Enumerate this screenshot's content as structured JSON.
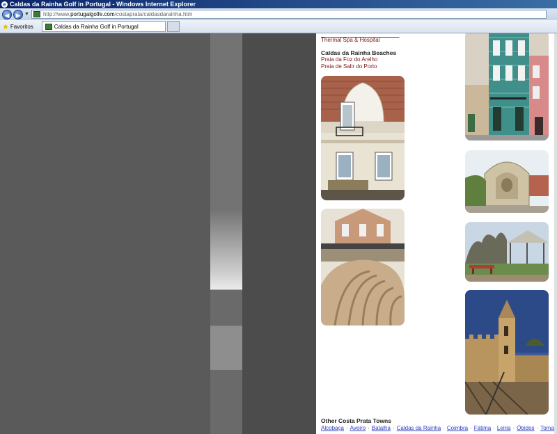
{
  "window": {
    "title": "Caldas da Rainha Golf in Portugal - Windows Internet Explorer"
  },
  "address": {
    "url_prefix": "http://www.",
    "url_host": "portugalgolfe.com",
    "url_path": "/costaprata/caldasdarainha.htm"
  },
  "toolbar": {
    "favorites_label": "Favoritos",
    "tab_title": "Caldas da Rainha Golf in Portugal"
  },
  "content": {
    "spa_link": "Thermal Spa & Hospital",
    "beaches_heading": "Caldas da Rainha Beaches",
    "beaches": [
      "Praia da Foz do Arelho",
      "Praia de Salir do Porto"
    ],
    "other_towns_heading": "Other Costa Prata Towns",
    "towns": [
      "Alcobaça",
      "Aveiro",
      "Batalha",
      "Caldas da Rainha",
      "Coimbra",
      "Fátima",
      "Leiria",
      "Óbidos",
      "Tomar"
    ],
    "town_separator": "·"
  },
  "colors": {
    "link": "#2d3cbd",
    "maroon_text": "#7a1a1a",
    "titlebar": "#0a246a"
  },
  "icons": [
    "ie-logo-icon",
    "back-icon",
    "forward-icon",
    "dropdown-icon",
    "site-favicon-icon",
    "favorites-star-icon"
  ]
}
